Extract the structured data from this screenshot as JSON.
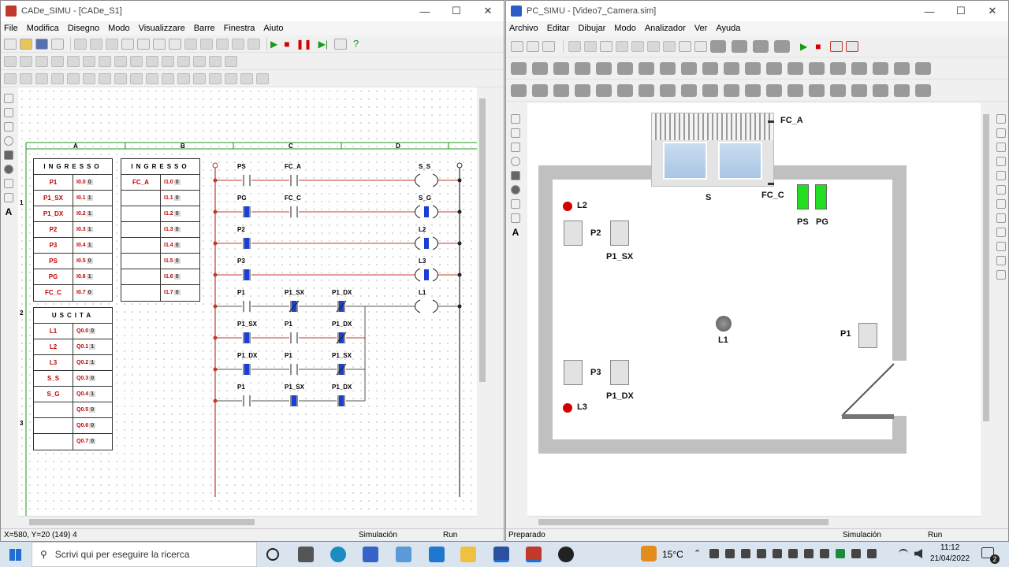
{
  "left_window": {
    "title": "CADe_SIMU - [CADe_S1]",
    "menus": [
      "File",
      "Modifica",
      "Disegno",
      "Modo",
      "Visualizzare",
      "Barre",
      "Finestra",
      "Aiuto"
    ],
    "status": {
      "coords": "X=580, Y=20 (149) 4",
      "mode": "Simulación",
      "run": "Run"
    },
    "columns": [
      "A",
      "B",
      "C",
      "D"
    ],
    "rows": [
      "1",
      "2",
      "3"
    ],
    "ingresso_title": "INGRESSO",
    "uscita_title": "USCITA",
    "ingresso_a": [
      {
        "name": "P1",
        "addr": "I0.0",
        "val": "0"
      },
      {
        "name": "P1_SX",
        "addr": "I0.1",
        "val": "1"
      },
      {
        "name": "P1_DX",
        "addr": "I0.2",
        "val": "1"
      },
      {
        "name": "P2",
        "addr": "I0.3",
        "val": "1"
      },
      {
        "name": "P3",
        "addr": "I0.4",
        "val": "1"
      },
      {
        "name": "PS",
        "addr": "I0.5",
        "val": "0"
      },
      {
        "name": "PG",
        "addr": "I0.6",
        "val": "1"
      },
      {
        "name": "FC_C",
        "addr": "I0.7",
        "val": "0"
      }
    ],
    "ingresso_b": [
      {
        "name": "FC_A",
        "addr": "I1.0",
        "val": "0"
      },
      {
        "name": "",
        "addr": "I1.1",
        "val": "0"
      },
      {
        "name": "",
        "addr": "I1.2",
        "val": "0"
      },
      {
        "name": "",
        "addr": "I1.3",
        "val": "0"
      },
      {
        "name": "",
        "addr": "I1.4",
        "val": "0"
      },
      {
        "name": "",
        "addr": "I1.5",
        "val": "0"
      },
      {
        "name": "",
        "addr": "I1.6",
        "val": "0"
      },
      {
        "name": "",
        "addr": "I1.7",
        "val": "0"
      }
    ],
    "uscita": [
      {
        "name": "L1",
        "addr": "Q0.0",
        "val": "0"
      },
      {
        "name": "L2",
        "addr": "Q0.1",
        "val": "1"
      },
      {
        "name": "L3",
        "addr": "Q0.2",
        "val": "1"
      },
      {
        "name": "S_S",
        "addr": "Q0.3",
        "val": "0"
      },
      {
        "name": "S_G",
        "addr": "Q0.4",
        "val": "1"
      },
      {
        "name": "",
        "addr": "Q0.5",
        "val": "0"
      },
      {
        "name": "",
        "addr": "Q0.6",
        "val": "0"
      },
      {
        "name": "",
        "addr": "Q0.7",
        "val": "0"
      }
    ],
    "rungs": [
      {
        "contacts": [
          "PS",
          "FC_A"
        ],
        "coil": "S_S"
      },
      {
        "contacts": [
          "PG",
          "FC_C"
        ],
        "coil": "S_G"
      },
      {
        "contacts": [
          "P2"
        ],
        "coil": "L2"
      },
      {
        "contacts": [
          "P3"
        ],
        "coil": "L3"
      },
      {
        "contacts": [
          "P1",
          "P1_SX",
          "P1_DX"
        ],
        "coil": "L1"
      },
      {
        "contacts": [
          "P1_SX",
          "P1",
          "P1_DX"
        ],
        "coil": ""
      },
      {
        "contacts": [
          "P1_DX",
          "P1",
          "P1_SX"
        ],
        "coil": ""
      },
      {
        "contacts": [
          "P1",
          "P1_SX",
          "P1_DX"
        ],
        "coil": ""
      }
    ]
  },
  "right_window": {
    "title": "PC_SIMU - [Video7_Camera.sim]",
    "menus": [
      "Archivo",
      "Editar",
      "Dibujar",
      "Modo",
      "Analizador",
      "Ver",
      "Ayuda"
    ],
    "status": {
      "left": "Preparado",
      "mode": "Simulación",
      "run": "Run"
    },
    "labels": {
      "fc_a": "FC_A",
      "fc_c": "FC_C",
      "s": "S",
      "ps": "PS",
      "pg": "PG",
      "l2": "L2",
      "p2": "P2",
      "p1_sx": "P1_SX",
      "l1": "L1",
      "p1": "P1",
      "p3": "P3",
      "p1_dx": "P1_DX",
      "l3": "L3"
    }
  },
  "taskbar": {
    "search_placeholder": "Scrivi qui per eseguire la ricerca",
    "temp": "15°C",
    "time": "11:12",
    "date": "21/04/2022",
    "notif": "2"
  },
  "colors": {
    "lamp_on": "#d40000",
    "btn_green": "#22dd22",
    "rail": "#c0392b",
    "blue_contact": "#1a3fd6"
  }
}
